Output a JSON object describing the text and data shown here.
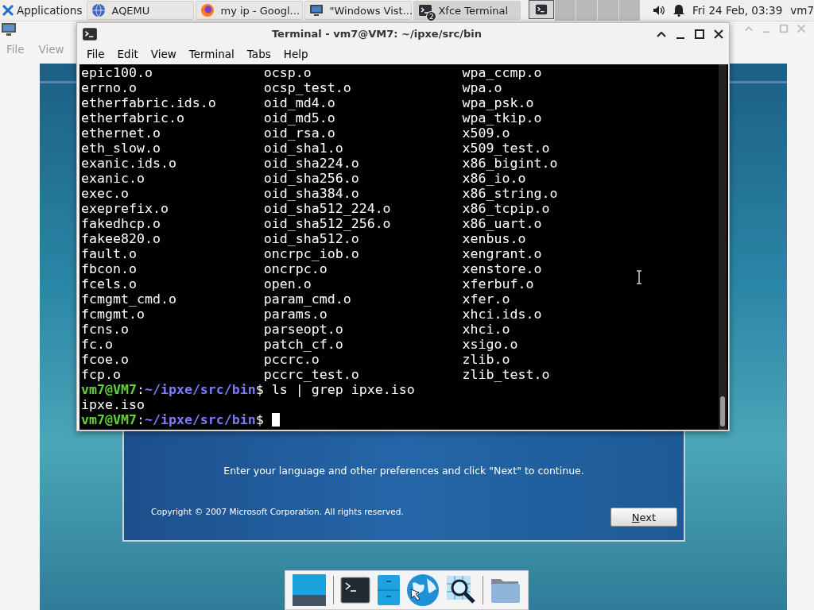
{
  "panel": {
    "menu": "Applications",
    "tasks": [
      {
        "label": "AQEMU",
        "selected": false
      },
      {
        "label": "my ip - Googl...",
        "selected": false
      },
      {
        "label": "\"Windows Vist...",
        "selected": false
      },
      {
        "label": "Xfce Terminal",
        "badge": "2",
        "selected": true
      }
    ],
    "clock": "Fri 24 Feb, 03:39",
    "user": "vm7"
  },
  "back_window": {
    "menu": [
      "File",
      "View"
    ]
  },
  "terminal": {
    "title": "Terminal - vm7@VM7: ~/ipxe/src/bin",
    "menu": [
      "File",
      "Edit",
      "View",
      "Terminal",
      "Tabs",
      "Help"
    ],
    "listing": [
      [
        "epic100.o",
        "ocsp.o",
        "wpa_ccmp.o"
      ],
      [
        "errno.o",
        "ocsp_test.o",
        "wpa.o"
      ],
      [
        "etherfabric.ids.o",
        "oid_md4.o",
        "wpa_psk.o"
      ],
      [
        "etherfabric.o",
        "oid_md5.o",
        "wpa_tkip.o"
      ],
      [
        "ethernet.o",
        "oid_rsa.o",
        "x509.o"
      ],
      [
        "eth_slow.o",
        "oid_sha1.o",
        "x509_test.o"
      ],
      [
        "exanic.ids.o",
        "oid_sha224.o",
        "x86_bigint.o"
      ],
      [
        "exanic.o",
        "oid_sha256.o",
        "x86_io.o"
      ],
      [
        "exec.o",
        "oid_sha384.o",
        "x86_string.o"
      ],
      [
        "exeprefix.o",
        "oid_sha512_224.o",
        "x86_tcpip.o"
      ],
      [
        "fakedhcp.o",
        "oid_sha512_256.o",
        "x86_uart.o"
      ],
      [
        "fakee820.o",
        "oid_sha512.o",
        "xenbus.o"
      ],
      [
        "fault.o",
        "oncrpc_iob.o",
        "xengrant.o"
      ],
      [
        "fbcon.o",
        "oncrpc.o",
        "xenstore.o"
      ],
      [
        "fcels.o",
        "open.o",
        "xferbuf.o"
      ],
      [
        "fcmgmt_cmd.o",
        "param_cmd.o",
        "xfer.o"
      ],
      [
        "fcmgmt.o",
        "params.o",
        "xhci.ids.o"
      ],
      [
        "fcns.o",
        "parseopt.o",
        "xhci.o"
      ],
      [
        "fc.o",
        "patch_cf.o",
        "xsigo.o"
      ],
      [
        "fcoe.o",
        "pccrc.o",
        "zlib.o"
      ],
      [
        "fcp.o",
        "pccrc_test.o",
        "zlib_test.o"
      ]
    ],
    "session": [
      {
        "kind": "prompt",
        "user_host": "vm7@VM7",
        "colon": ":",
        "path": "~/ipxe/src/bin",
        "command": "$ ls | grep ipxe.iso",
        "cursor": false
      },
      {
        "kind": "output",
        "text": "ipxe.iso"
      },
      {
        "kind": "prompt",
        "user_host": "vm7@VM7",
        "colon": ":",
        "path": "~/ipxe/src/bin",
        "command": "$ ",
        "cursor": true
      }
    ]
  },
  "setup": {
    "message": "Enter your language and other preferences and click \"Next\" to continue.",
    "copyright": "Copyright © 2007 Microsoft Corporation. All rights reserved.",
    "button": "Next"
  },
  "dock": [
    {
      "kind": "launcher"
    },
    {
      "kind": "separator"
    },
    {
      "kind": "launcher"
    },
    {
      "kind": "launcher"
    },
    {
      "kind": "launcher"
    },
    {
      "kind": "launcher"
    },
    {
      "kind": "separator"
    },
    {
      "kind": "launcher"
    }
  ]
}
